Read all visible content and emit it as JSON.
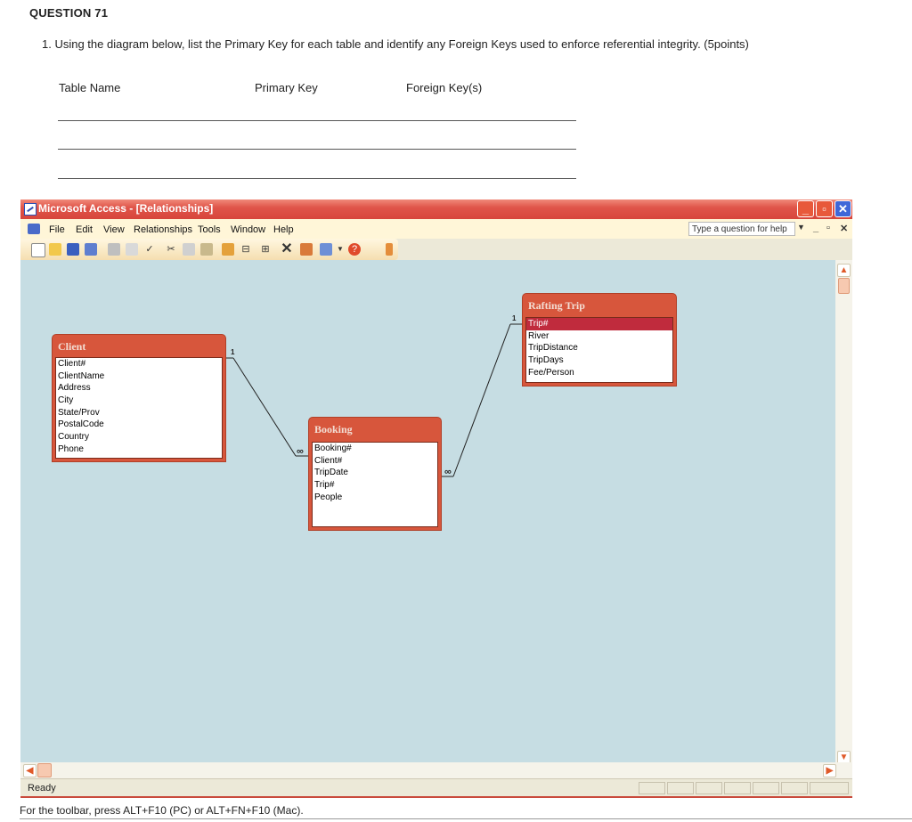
{
  "question": {
    "title": "QUESTION 71",
    "text": "1. Using the diagram below, list the Primary Key for each table and identify any Foreign Keys used to enforce referential integrity.  (5points)",
    "columns": [
      "Table Name",
      "Primary Key",
      "Foreign Key(s)"
    ]
  },
  "window": {
    "title": "Microsoft Access - [Relationships]",
    "menu": [
      "File",
      "Edit",
      "View",
      "Relationships",
      "Tools",
      "Window",
      "Help"
    ],
    "help_placeholder": "Type a question for help",
    "status": "Ready"
  },
  "tables": {
    "client": {
      "title": "Client",
      "fields": [
        "Client#",
        "ClientName",
        "Address",
        "City",
        "State/Prov",
        "PostalCode",
        "Country",
        "Phone"
      ]
    },
    "booking": {
      "title": "Booking",
      "fields": [
        "Booking#",
        "Client#",
        "TripDate",
        "Trip#",
        "People"
      ]
    },
    "rafting_trip": {
      "title": "Rafting Trip",
      "fields": [
        "Trip#",
        "River",
        "TripDistance",
        "TripDays",
        "Fee/Person"
      ]
    }
  },
  "relationships": [
    {
      "from": "Client.Client#",
      "to": "Booking.Client#",
      "one_label": "1",
      "many_label": "∞"
    },
    {
      "from": "Rafting Trip.Trip#",
      "to": "Booking.Trip#",
      "one_label": "1",
      "many_label": "∞"
    }
  ],
  "footer": "For the toolbar, press ALT+F10 (PC) or ALT+FN+F10 (Mac).",
  "colors": {
    "title_bar": "#d7453b",
    "canvas": "#c6dde3",
    "table_frame": "#d7563c",
    "selected_field": "#c02b3d"
  }
}
